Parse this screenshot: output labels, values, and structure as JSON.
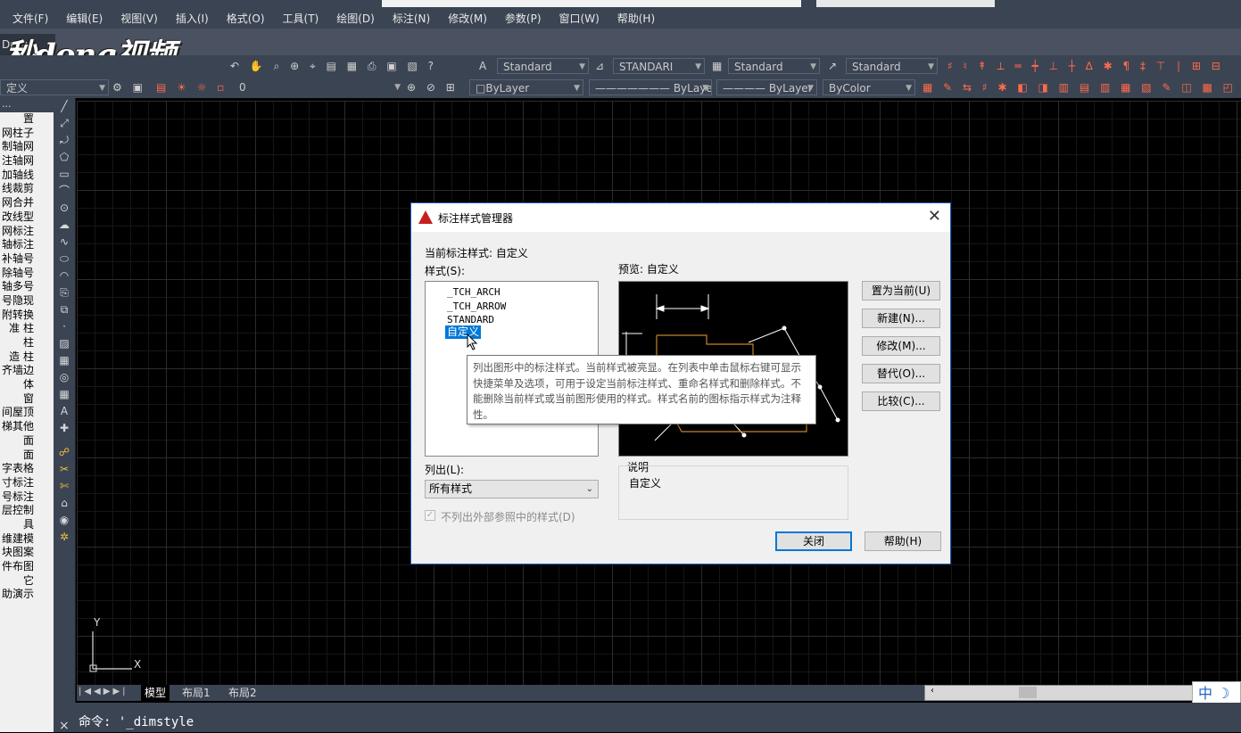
{
  "menu": {
    "items": [
      "文件(F)",
      "编辑(E)",
      "视图(V)",
      "插入(I)",
      "格式(O)",
      "工具(T)",
      "绘图(D)",
      "标注(N)",
      "修改(M)",
      "参数(P)",
      "窗口(W)",
      "帮助(H)"
    ]
  },
  "tabbar": {
    "tab_label": "Drav",
    "logo_text": "秒dong视频"
  },
  "toolbar1": {
    "text_style": "Standard",
    "dim_style": "STANDARI",
    "table_style": "Standard",
    "multileader_style": "Standard"
  },
  "toolbar2": {
    "workspace": "定义",
    "layer": "0",
    "color": "ByLayer",
    "linetype": "ByLayer",
    "lineweight": "ByLayer",
    "plotstyle": "ByColor"
  },
  "leftpanel": {
    "title": "...",
    "items": [
      "置",
      "网柱子",
      "制轴网",
      "注轴网",
      "加轴线",
      "线裁剪",
      "网合并",
      "改线型",
      "网标注",
      "轴标注",
      "补轴号",
      "除轴号",
      "轴多号",
      "号隐现",
      "附转换",
      "准 柱",
      "柱",
      "造 柱",
      "齐墙边",
      "体",
      "窗",
      "间屋顶",
      "梯其他",
      "面",
      "面",
      "字表格",
      "寸标注",
      "号标注",
      "层控制",
      "具",
      "维建模",
      "块图案",
      "件布图",
      "它",
      "助演示"
    ]
  },
  "drawtools": {
    "icons": [
      "line-icon",
      "xline-icon",
      "polyline-icon",
      "polygon-icon",
      "rectangle-icon",
      "arc-icon",
      "circle-icon",
      "revcloud-icon",
      "spline-icon",
      "ellipse-icon",
      "ellipse-arc-icon",
      "insert-block-icon",
      "make-block-icon",
      "point-icon",
      "hatch-icon",
      "gradient-icon",
      "region-icon",
      "table-icon",
      "mtext-icon",
      "add-selected-icon"
    ]
  },
  "layout_tabs": [
    "模型",
    "布局1",
    "布局2"
  ],
  "ime": {
    "label": "中",
    "moon": "☽"
  },
  "command": {
    "text": "命令: '_dimstyle",
    "close": "×"
  },
  "dialog": {
    "title": "标注样式管理器",
    "current_style_label": "当前标注样式: 自定义",
    "styles_label": "样式(S):",
    "styles": [
      "_TCH_ARCH",
      "_TCH_ARROW",
      "STANDARD",
      "自定义"
    ],
    "selected_style": "自定义",
    "tooltip": "列出图形中的标注样式。当前样式被亮显。在列表中单击鼠标右键可显示快捷菜单及选项，可用于设定当前标注样式、重命名样式和删除样式。不能删除当前样式或当前图形使用的样式。样式名前的图标指示样式为注释性。",
    "preview_label": "预览: 自定义",
    "list_label": "列出(L):",
    "list_value": "所有样式",
    "checkbox_label": "不列出外部参照中的样式(D)",
    "desc_label": "说明",
    "desc_value": "自定义",
    "buttons": {
      "set_current": "置为当前(U)",
      "new": "新建(N)...",
      "modify": "修改(M)...",
      "override": "替代(O)...",
      "compare": "比较(C)...",
      "close": "关闭",
      "help": "帮助(H)"
    }
  },
  "colors": {
    "ui_dark": "#3b4453",
    "selection": "#0078d7",
    "autocad_red": "#c81e1e",
    "preview_shape": "#c8822a"
  }
}
